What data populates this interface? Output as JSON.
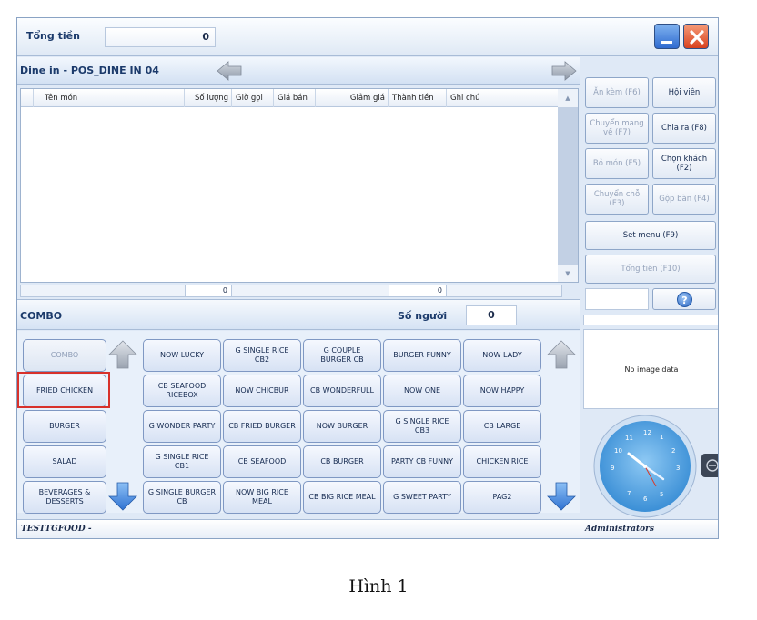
{
  "top": {
    "total_label": "Tổng tiền",
    "total_value": "0"
  },
  "order": {
    "title": "Dine in - POS_DINE IN 04",
    "columns": [
      "Tên món",
      "Số lượng",
      "Giờ gọi",
      "Giá bán",
      "Giảm giá",
      "Thành tiền",
      "Ghi chú"
    ],
    "sum_qty": "0",
    "sum_total": "0"
  },
  "menu": {
    "title": "COMBO",
    "guests_label": "Số người",
    "guests_value": "0",
    "categories": [
      "COMBO",
      "FRIED CHICKEN",
      "BURGER",
      "SALAD",
      "BEVERAGES & DESSERTS"
    ],
    "items": [
      [
        "NOW LUCKY",
        "G SINGLE RICE CB2",
        "G COUPLE BURGER CB",
        "BURGER FUNNY",
        "NOW LADY"
      ],
      [
        "CB SEAFOOD RICEBOX",
        "NOW CHICBUR",
        "CB WONDERFULL",
        "NOW ONE",
        "NOW HAPPY"
      ],
      [
        "G WONDER PARTY",
        "CB FRIED BURGER",
        "NOW BURGER",
        "G SINGLE RICE CB3",
        "CB LARGE"
      ],
      [
        "G SINGLE RICE CB1",
        "CB SEAFOOD",
        "CB BURGER",
        "PARTY CB FUNNY",
        "CHICKEN RICE"
      ],
      [
        "G SINGLE BURGER CB",
        "NOW BIG RICE MEAL",
        "CB BIG RICE MEAL",
        "G SWEET PARTY",
        "PAG2"
      ]
    ]
  },
  "actions": {
    "an_kem": "Ăn kèm (F6)",
    "hoi_vien": "Hội viên",
    "chuyen_mang_ve": "Chuyển mang về (F7)",
    "chia_ra": "Chia ra (F8)",
    "bo_mon": "Bỏ món (F5)",
    "chon_khach": "Chọn khách (F2)",
    "chuyen_cho": "Chuyển chỗ (F3)",
    "gop_ban": "Gộp bàn (F4)",
    "set_menu": "Set menu (F9)",
    "tong_tien": "Tổng tiền (F10)"
  },
  "panel": {
    "no_image": "No image data"
  },
  "clock": {
    "numbers": [
      "12",
      "1",
      "2",
      "3",
      "5",
      "6",
      "7",
      "9",
      "10",
      "11"
    ]
  },
  "status": {
    "left": "TESTTGFOOD -",
    "right": "Administrators"
  },
  "caption": "Hình 1",
  "colors": {
    "highlight": "#d8312b",
    "accent": "#2f6bd0",
    "close": "#d9411e"
  }
}
